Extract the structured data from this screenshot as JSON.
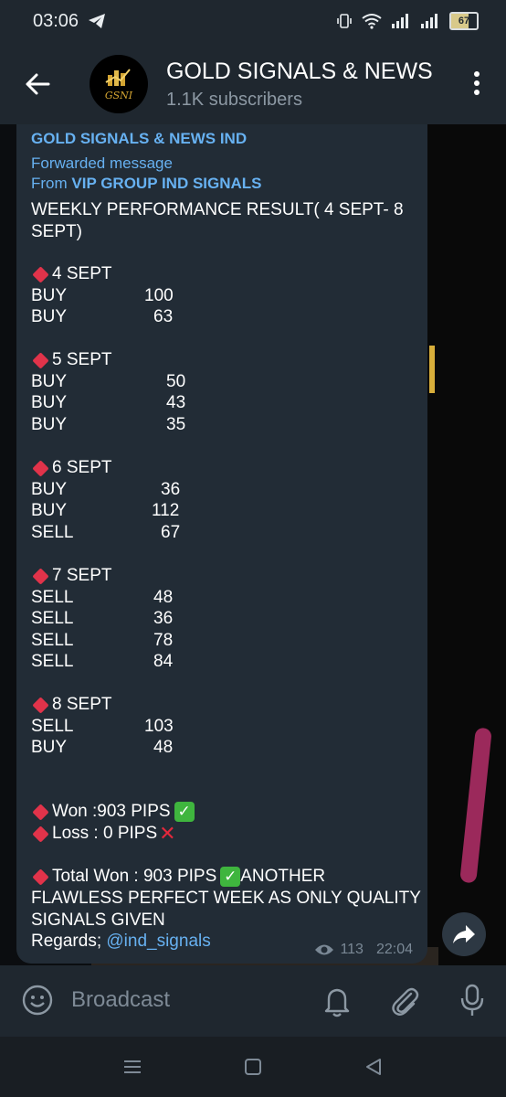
{
  "status_bar": {
    "time": "03:06",
    "battery": "67"
  },
  "header": {
    "title": "GOLD SIGNALS & NEWS",
    "subtitle": "1.1K subscribers",
    "avatar_text": "GSNI"
  },
  "message": {
    "channel": "GOLD SIGNALS & NEWS IND",
    "forwarded_label": "Forwarded message",
    "from_prefix": "From ",
    "from_name": "VIP GROUP IND SIGNALS",
    "heading_line1": "WEEKLY PERFORMANCE RESULT( 4 SEPT- 8",
    "heading_line2": "SEPT)",
    "days": [
      {
        "label": "4 SEPT",
        "trades": [
          {
            "side": "BUY",
            "pips": "100"
          },
          {
            "side": "BUY",
            "pips": "63"
          }
        ]
      },
      {
        "label": "5 SEPT",
        "trades": [
          {
            "side": "BUY",
            "pips": "50"
          },
          {
            "side": "BUY",
            "pips": "43"
          },
          {
            "side": "BUY",
            "pips": "35"
          }
        ]
      },
      {
        "label": "6 SEPT",
        "trades": [
          {
            "side": "BUY",
            "pips": "36"
          },
          {
            "side": "BUY",
            "pips": "112"
          },
          {
            "side": "SELL",
            "pips": "67"
          }
        ]
      },
      {
        "label": "7 SEPT",
        "trades": [
          {
            "side": "SELL",
            "pips": "48"
          },
          {
            "side": "SELL",
            "pips": "36"
          },
          {
            "side": "SELL",
            "pips": "78"
          },
          {
            "side": "SELL",
            "pips": "84"
          }
        ]
      },
      {
        "label": "8 SEPT",
        "trades": [
          {
            "side": "SELL",
            "pips": "103"
          },
          {
            "side": "BUY",
            "pips": "48"
          }
        ]
      }
    ],
    "won": "Won :903 PIPS",
    "loss": "Loss : 0 PIPS",
    "total_line1": "Total Won : 903 PIPS",
    "total_line1_suffix": "ANOTHER",
    "total_line2": "FLAWLESS PERFECT WEEK AS ONLY QUALITY",
    "total_line3": "SIGNALS GIVEN",
    "regards_prefix": "Regards; ",
    "mention": "@ind_signals",
    "views": "113",
    "time": "22:04"
  },
  "input": {
    "placeholder": "Broadcast"
  },
  "colors": {
    "accent": "#67b1f1",
    "bubble": "#222c36",
    "header": "#1f272f",
    "diamond": "#e1334a",
    "check": "#3fb53e"
  },
  "icons": [
    "telegram-icon",
    "vibrate-icon",
    "wifi-icon",
    "signal-icon",
    "battery-icon",
    "back-arrow-icon",
    "more-icon",
    "share-icon",
    "eye-icon",
    "smile-icon",
    "bell-icon",
    "paperclip-icon",
    "mic-icon",
    "nav-menu-icon",
    "nav-home-icon",
    "nav-back-icon"
  ]
}
